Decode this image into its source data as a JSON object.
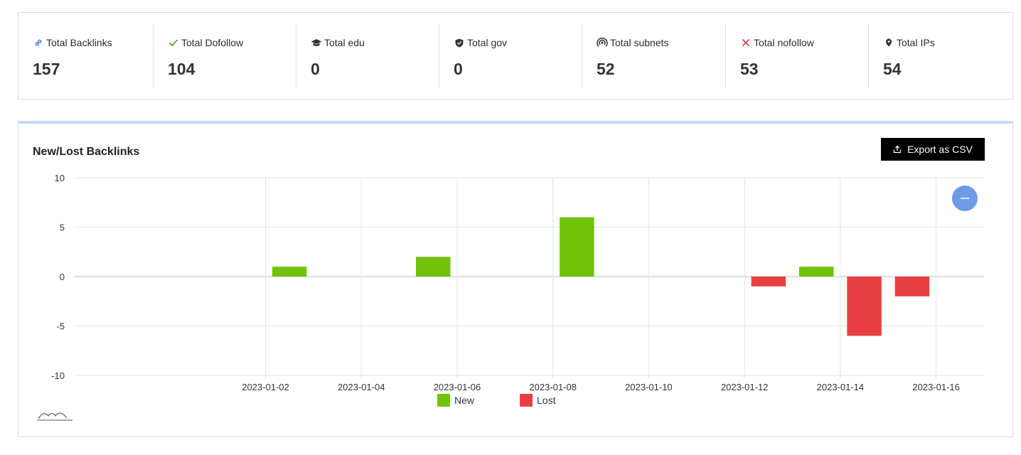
{
  "stats": [
    {
      "label": "Total Backlinks",
      "value": "157",
      "icon": "link-icon"
    },
    {
      "label": "Total Dofollow",
      "value": "104",
      "icon": "check-icon"
    },
    {
      "label": "Total edu",
      "value": "0",
      "icon": "graduation-cap-icon"
    },
    {
      "label": "Total gov",
      "value": "0",
      "icon": "shield-icon"
    },
    {
      "label": "Total subnets",
      "value": "52",
      "icon": "signal-icon"
    },
    {
      "label": "Total nofollow",
      "value": "53",
      "icon": "x-icon"
    },
    {
      "label": "Total IPs",
      "value": "54",
      "icon": "map-pin-icon"
    }
  ],
  "chart_panel": {
    "title": "New/Lost Backlinks",
    "export_label": "Export as CSV"
  },
  "colors": {
    "new": "#72c20a",
    "lost": "#e84042",
    "accent": "#6f9be6",
    "link": "#2f6ed8",
    "check": "#3c9a17",
    "cross": "#e03c3c"
  },
  "chart_data": {
    "type": "bar",
    "x_type": "date",
    "x_ticks": [
      "2023-01-02",
      "2023-01-04",
      "2023-01-06",
      "2023-01-08",
      "2023-01-10",
      "2023-01-12",
      "2023-01-14",
      "2023-01-16"
    ],
    "xlim": [
      "2022-12-29",
      "2023-01-17"
    ],
    "ylim": [
      -10,
      10
    ],
    "y_ticks": [
      10,
      5,
      0,
      -5,
      -10
    ],
    "grid": true,
    "legend_position": "bottom",
    "series": [
      {
        "name": "New",
        "color": "#72c20a",
        "points": [
          {
            "x": "2023-01-02",
            "y": 1
          },
          {
            "x": "2023-01-05",
            "y": 2
          },
          {
            "x": "2023-01-08",
            "y": 6
          },
          {
            "x": "2023-01-13",
            "y": 1
          }
        ]
      },
      {
        "name": "Lost",
        "color": "#e84042",
        "points": [
          {
            "x": "2023-01-12",
            "y": -1
          },
          {
            "x": "2023-01-14",
            "y": -6
          },
          {
            "x": "2023-01-15",
            "y": -2
          }
        ]
      }
    ]
  }
}
